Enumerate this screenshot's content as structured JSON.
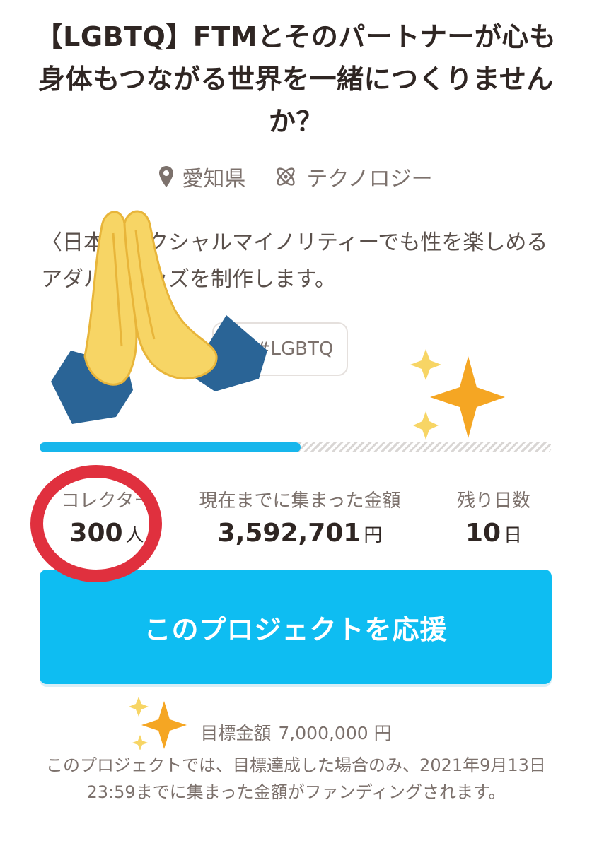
{
  "project": {
    "title": "【LGBTQ】FTMとそのパートナーが心も身体もつながる世界を一緒につくりませんか？",
    "location": "愛知県",
    "category": "テクノロジー",
    "summary": "〈日本のセクシャルマイノリティーでも性を楽しめるアダルトグッズを制作します。",
    "tag": "#LGBTQ",
    "progress_percent": 51
  },
  "stats": {
    "collectors_label": "コレクター",
    "collectors_value": "300",
    "collectors_unit": "人",
    "amount_label": "現在までに集まった金額",
    "amount_value": "3,592,701",
    "amount_unit": "円",
    "days_label": "残り日数",
    "days_value": "10",
    "days_unit": "日"
  },
  "cta": {
    "label": "このプロジェクトを応援"
  },
  "goal": {
    "label": "目標金額",
    "value": "7,000,000 円"
  },
  "note": "このプロジェクトでは、目標達成した場合のみ、2021年9月13日23:59までに集まった金額がファンディングされます。",
  "colors": {
    "accent": "#0ebdf2",
    "progress": "#17b6ec",
    "highlight_circle": "#e0303e",
    "sparkle": "#f5a623"
  },
  "icons": [
    "location-pin-icon",
    "atom-icon",
    "praying-hands-emoji",
    "sparkles-emoji"
  ]
}
